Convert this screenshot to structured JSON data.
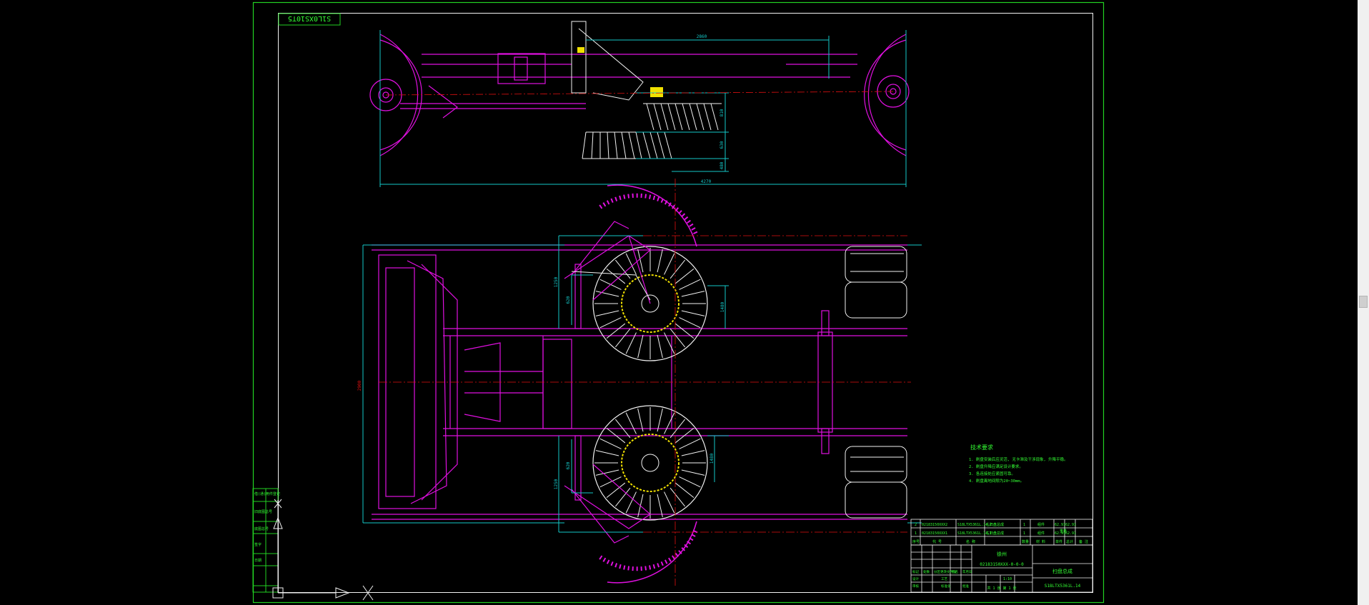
{
  "colors": {
    "background": "#000000",
    "border": "#22d122",
    "magenta": "#e010e0",
    "cyan": "#14c8c8",
    "white": "#f2f2f2",
    "yellow": "#f0e000",
    "red": "#e01010",
    "green_text": "#33ff33"
  },
  "sheet": {
    "stamp_label": "S1L0XS10T5"
  },
  "dimensions": {
    "top_overall_width": "4270",
    "top_upper": "2860",
    "top_right_1": "810",
    "top_right_2": "630",
    "top_right_3": "480",
    "plan_left_upper": "1250",
    "plan_left_inner_upper": "620",
    "plan_right_upper": "1480",
    "plan_left_lower": "1250",
    "plan_left_inner_lower": "620",
    "plan_right_lower": "1480",
    "plan_overall_height": "2900"
  },
  "notes": {
    "title": "技术要求",
    "items": [
      "1. 刷盘安装后应灵活, 无卡滞及干涉现象, 升降平稳。",
      "2. 刷盘升降应满足设计要求。",
      "3. 各连接处应紧固可靠。",
      "4. 刷盘离地间隙为20~30mm。"
    ]
  },
  "bom": {
    "rows": [
      {
        "no": "2",
        "code": "02183150XXX2",
        "name": "S18LTX5361L.14.2",
        "desc": "右扫盘总成",
        "qty": "1",
        "material": "组件",
        "w1": "62.91",
        "w2": "62.91"
      },
      {
        "no": "1",
        "code": "02183150XXX1",
        "name": "S18LTX5361L.14.1",
        "desc": "左扫盘总成",
        "qty": "1",
        "material": "组件",
        "w1": "62.91",
        "w2": "62.91"
      }
    ],
    "headers": [
      "序号",
      "代 号",
      "名 称",
      "数量",
      "材 料",
      "单件",
      "总计",
      "备 注"
    ],
    "weight_header": "重量"
  },
  "title_block": {
    "company": "徐州",
    "project_code": "02183150XXX-0-0-0",
    "drawing_name": "扫盘总成",
    "drawing_number": "S18LTX5361L.14",
    "scale": "1:10",
    "sheets": "共 1 张 第 1 张",
    "left_labels": [
      "标记",
      "处数",
      "分区",
      "更改文件号",
      "签名",
      "年月日"
    ],
    "role_labels": [
      "设计",
      "审核",
      "工艺",
      "标准化",
      "批准"
    ]
  },
  "side_column": {
    "labels": [
      "借(通)用件登记",
      "旧底图总号",
      "底图总号",
      "签字",
      "日期"
    ]
  }
}
